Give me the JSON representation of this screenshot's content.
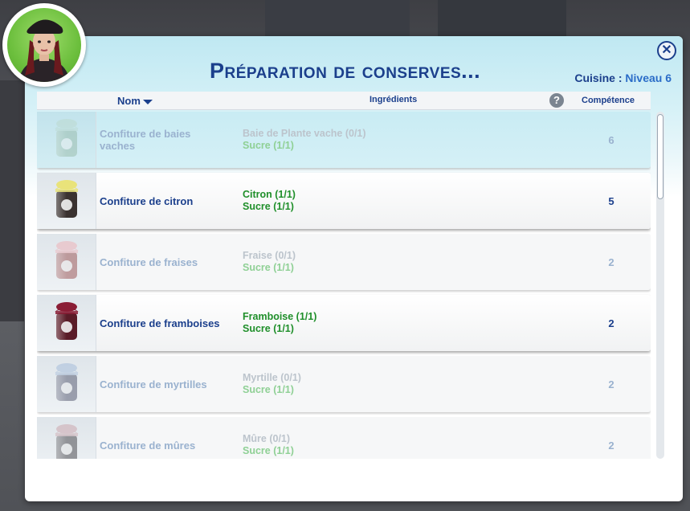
{
  "dialog": {
    "title": "Préparation de conserves...",
    "skill_label": "Cuisine",
    "skill_sep": " : ",
    "skill_level": "Niveau 6",
    "close_symbol": "✕"
  },
  "columns": {
    "name": "Nom",
    "ingredients": "Ingrédients",
    "help": "?",
    "skill": "Compétence"
  },
  "recipes": [
    {
      "name": "Confiture de baies vaches",
      "ingredient": "Baie de Plante vache (0/1)",
      "sugar": "Sucre (1/1)",
      "skill": "6",
      "available": false,
      "jar_color": "#8fb4a0",
      "lid_color": "#b9d7c9"
    },
    {
      "name": "Confiture de citron",
      "ingredient": "Citron (1/1)",
      "sugar": "Sucre (1/1)",
      "skill": "5",
      "available": true,
      "jar_color": "#3a3230",
      "lid_color": "#e9e37a"
    },
    {
      "name": "Confiture de fraises",
      "ingredient": "Fraise (0/1)",
      "sugar": "Sucre (1/1)",
      "skill": "2",
      "available": false,
      "jar_color": "#8d3a3a",
      "lid_color": "#f0a7ae"
    },
    {
      "name": "Confiture de framboises",
      "ingredient": "Framboise (1/1)",
      "sugar": "Sucre (1/1)",
      "skill": "2",
      "available": true,
      "jar_color": "#5a1c28",
      "lid_color": "#8a1d35"
    },
    {
      "name": "Confiture de myrtilles",
      "ingredient": "Myrtille (0/1)",
      "sugar": "Sucre (1/1)",
      "skill": "2",
      "available": false,
      "jar_color": "#3b3f5a",
      "lid_color": "#9ab4d6"
    },
    {
      "name": "Confiture de mûres",
      "ingredient": "Mûre (0/1)",
      "sugar": "Sucre (1/1)",
      "skill": "2",
      "available": false,
      "jar_color": "#2c2a30",
      "lid_color": "#c79aa2"
    }
  ],
  "colors": {
    "title": "#1b3f8c",
    "available_ingredient": "#1f8f2a",
    "disabled_text": "#9ab2cf"
  }
}
